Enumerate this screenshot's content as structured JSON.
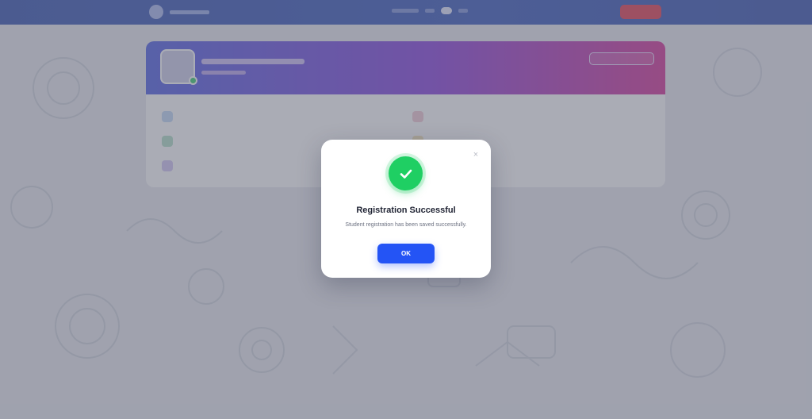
{
  "colors": {
    "topbar": "#1e3fa8",
    "success": "#1fcf63",
    "primary_button": "#2454f5",
    "logout": "#e0243a"
  },
  "modal": {
    "icon": "checkmark-icon",
    "close_icon": "close-icon",
    "close_glyph": "×",
    "title": "Registration Successful",
    "message": "Student registration has been saved successfully.",
    "ok_label": "OK"
  }
}
